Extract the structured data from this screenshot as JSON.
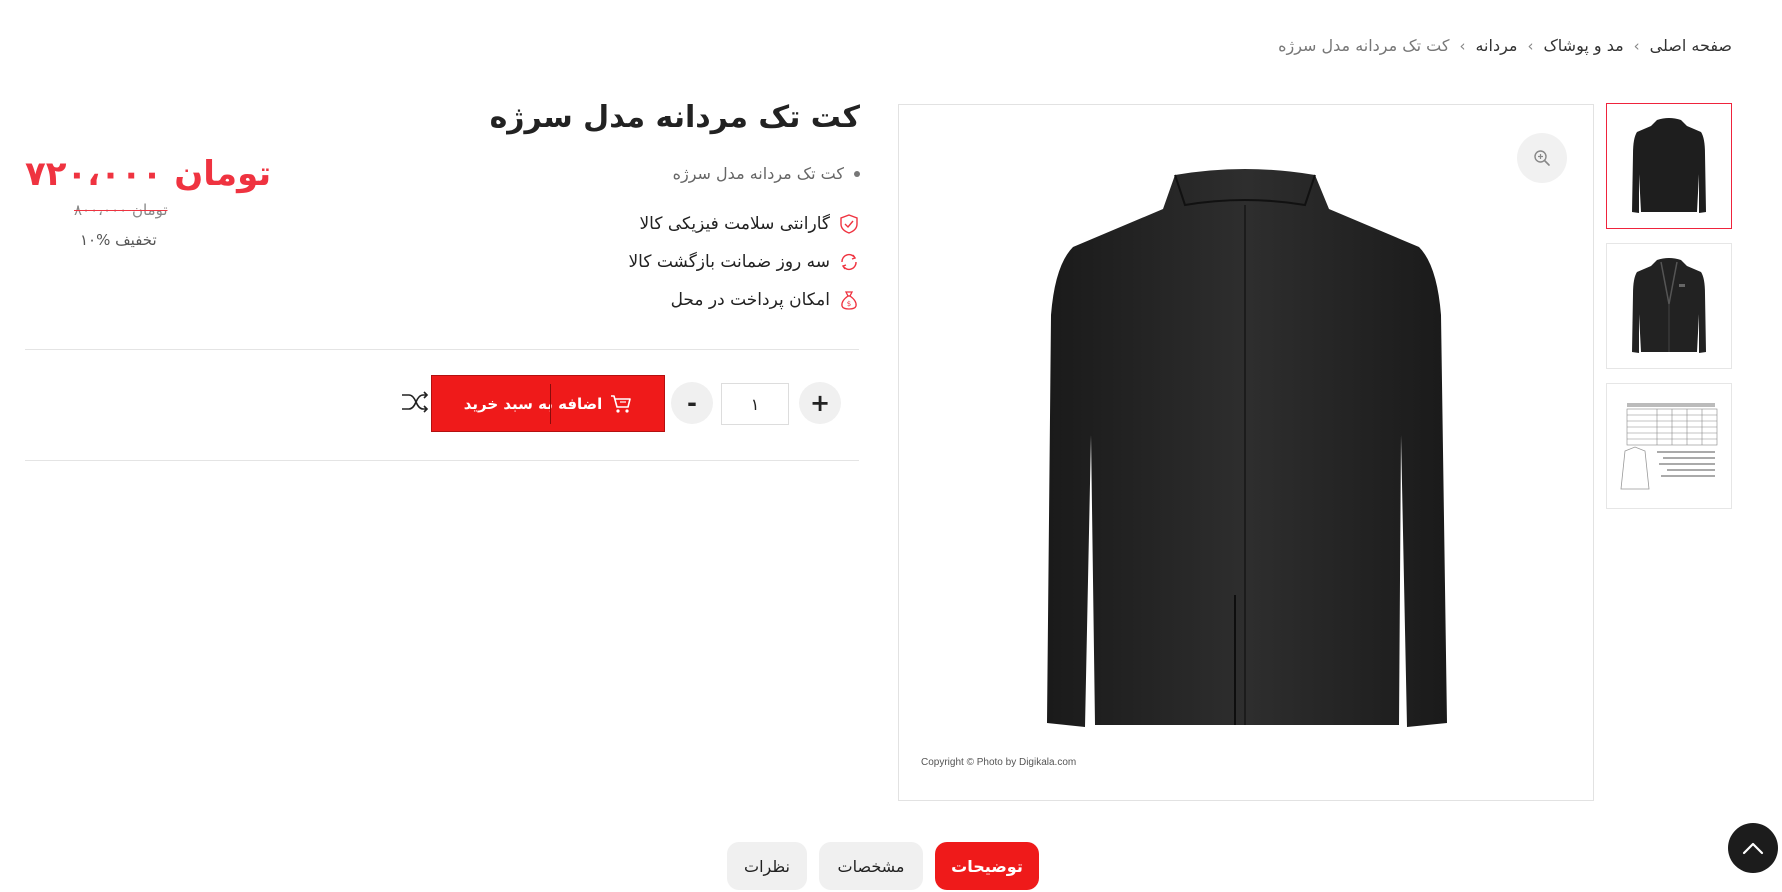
{
  "breadcrumb": {
    "items": [
      "صفحه اصلی",
      "مد و پوشاک",
      "مردانه"
    ],
    "current": "کت تک مردانه مدل سرژه"
  },
  "gallery": {
    "thumbnails": [
      {
        "icon": "jacket-back-thumbnail"
      },
      {
        "icon": "jacket-front-thumbnail"
      },
      {
        "icon": "size-chart-thumbnail"
      }
    ],
    "active_index": 0,
    "zoom_icon": "zoom-in-icon",
    "copyright": "Copyright © Photo by Digikala.com"
  },
  "product": {
    "title": "کت تک مردانه مدل سرژه",
    "short_description": "کت تک مردانه مدل سرژه",
    "features": [
      {
        "icon": "shield-check-icon",
        "label": "گارانتی سلامت فیزیکی کالا"
      },
      {
        "icon": "refresh-icon",
        "label": "سه روز ضمانت بازگشت کالا"
      },
      {
        "icon": "money-bag-icon",
        "label": "امکان پرداخت در محل"
      }
    ]
  },
  "pricing": {
    "price": "۷۲۰،۰۰۰ تومان",
    "old_price": "۸۰۰،۰۰۰ تومان",
    "discount": "۱۰% تخفیف"
  },
  "cart": {
    "quantity": "۱",
    "plus_label": "+",
    "minus_label": "-",
    "add_to_cart_label": "اضافه به سبد خرید",
    "compare_icon": "shuffle-icon"
  },
  "tabs": [
    {
      "label": "توضیحات",
      "active": true
    },
    {
      "label": "مشخصات",
      "active": false
    },
    {
      "label": "نظرات",
      "active": false
    }
  ],
  "colors": {
    "accent": "#ef1a1a",
    "price": "#ef3340",
    "dark": "#1c1c1c"
  }
}
